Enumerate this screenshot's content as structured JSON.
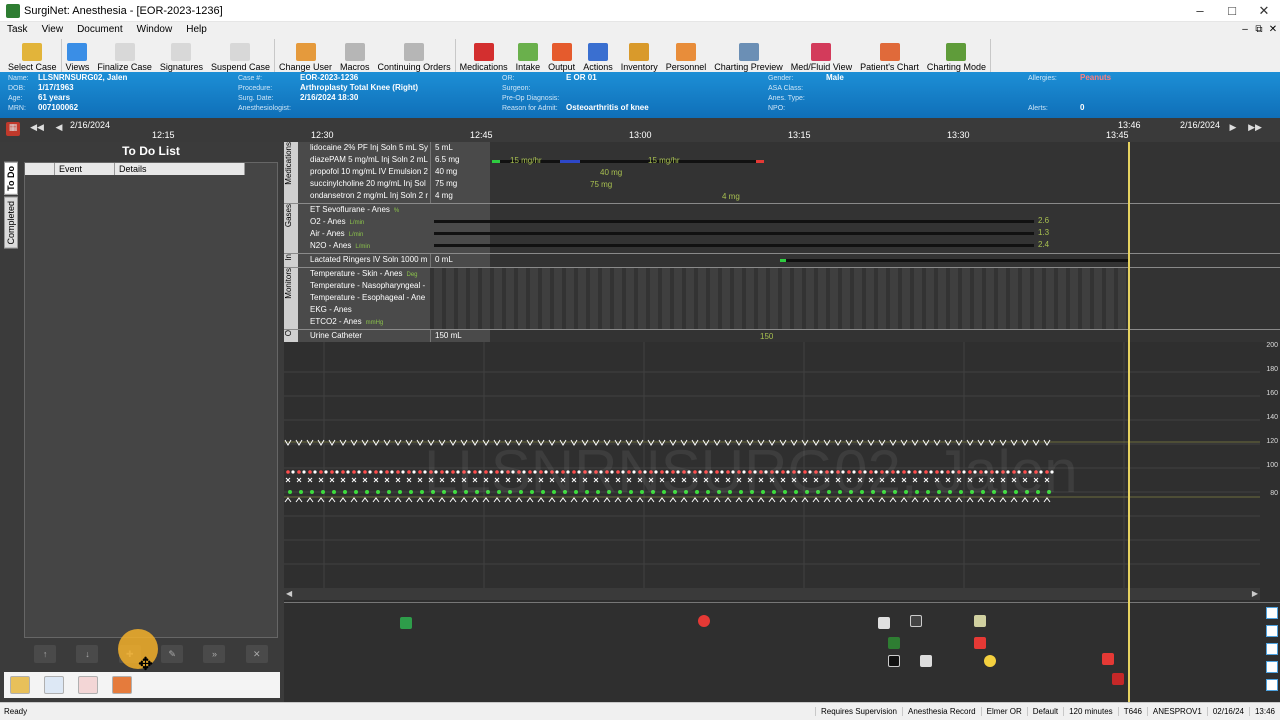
{
  "window": {
    "title": "SurgiNet: Anesthesia - [EOR-2023-1236]"
  },
  "menu": [
    "Task",
    "View",
    "Document",
    "Window",
    "Help"
  ],
  "toolbar": [
    {
      "label": "Select Case",
      "icon": "folder-icon",
      "color": "#e2b43a"
    },
    {
      "label": "Views",
      "icon": "window-icon",
      "color": "#3a8ee6"
    },
    {
      "label": "Finalize Case",
      "icon": "document-icon",
      "color": "#d8d8d8"
    },
    {
      "label": "Signatures",
      "icon": "signature-icon",
      "color": "#d8d8d8"
    },
    {
      "label": "Suspend Case",
      "icon": "suspend-icon",
      "color": "#d8d8d8"
    },
    {
      "label": "Change User",
      "icon": "users-icon",
      "color": "#e59a3c"
    },
    {
      "label": "Macros",
      "icon": "macros-icon",
      "color": "#b6b6b6"
    },
    {
      "label": "Continuing Orders",
      "icon": "orders-icon",
      "color": "#b6b6b6"
    },
    {
      "label": "Medications",
      "icon": "pill-icon",
      "color": "#d32f2f"
    },
    {
      "label": "Intake",
      "icon": "iv-bag-icon",
      "color": "#6ab04c"
    },
    {
      "label": "Output",
      "icon": "output-icon",
      "color": "#e55b2d"
    },
    {
      "label": "Actions",
      "icon": "checklist-icon",
      "color": "#3a6fd0"
    },
    {
      "label": "Inventory",
      "icon": "inventory-icon",
      "color": "#d99a2b"
    },
    {
      "label": "Personnel",
      "icon": "people-icon",
      "color": "#e88d3a"
    },
    {
      "label": "Charting Preview",
      "icon": "chart-preview-icon",
      "color": "#6b8fb5"
    },
    {
      "label": "Med/Fluid View",
      "icon": "med-fluid-icon",
      "color": "#d33b5b"
    },
    {
      "label": "Patient's Chart",
      "icon": "patient-chart-icon",
      "color": "#e06a3a"
    },
    {
      "label": "Charting Mode",
      "icon": "charting-mode-icon",
      "color": "#5f9c3a"
    }
  ],
  "patient": {
    "name_label": "Name:",
    "name": "LLSNRNSURG02, Jalen",
    "dob_label": "DOB:",
    "dob": "1/17/1963",
    "age_label": "Age:",
    "age": "61 years",
    "mrn_label": "MRN:",
    "mrn": "007100062",
    "case_label": "Case #:",
    "case": "EOR-2023-1236",
    "procedure_label": "Procedure:",
    "procedure": "Arthroplasty Total Knee (Right)",
    "surgdate_label": "Surg. Date:",
    "surgdate": "2/16/2024 18:30",
    "anesthesiologist_label": "Anesthesiologist:",
    "or_label": "OR:",
    "or": "E OR 01",
    "surgeon_label": "Surgeon:",
    "preop_label": "Pre-Op Diagnosis:",
    "reason_label": "Reason for Admit:",
    "reason": "Osteoarthritis of knee",
    "gender_label": "Gender:",
    "gender": "Male",
    "asa_label": "ASA Class:",
    "anestype_label": "Anes. Type:",
    "npo_label": "NPO:",
    "allergies_label": "Allergies:",
    "allergies": "Peanuts",
    "alerts_label": "Alerts:",
    "alerts": "0"
  },
  "timeline": {
    "date_left": "2/16/2024",
    "date_right": "2/16/2024",
    "ticks": [
      "12:15",
      "12:30",
      "12:45",
      "13:00",
      "13:15",
      "13:30",
      "13:45"
    ],
    "now": "13:46"
  },
  "todo": {
    "title": "To Do List",
    "tabs": [
      "To Do",
      "Completed"
    ],
    "columns": [
      "Event",
      "Details"
    ]
  },
  "sections": {
    "medications": {
      "tab": "Medications",
      "rows": [
        {
          "label": "lidocaine 2% PF Inj Soln 5 mL Sy",
          "value": "5 mL"
        },
        {
          "label": "diazePAM 5 mg/mL Inj Soln 2 mL",
          "value": "6.5 mg"
        },
        {
          "label": "propofol 10 mg/mL IV Emulsion 2",
          "value": "40 mg"
        },
        {
          "label": "succinylcholine 20 mg/mL Inj Sol",
          "value": "75 mg"
        },
        {
          "label": "ondansetron 2 mg/mL Inj Soln 2 r",
          "value": "4 mg"
        }
      ],
      "events": [
        {
          "text": "15 mg/hr"
        },
        {
          "text": "15 mg/hr"
        },
        {
          "text": "40 mg"
        },
        {
          "text": "75 mg"
        },
        {
          "text": "4 mg"
        }
      ]
    },
    "gases": {
      "tab": "Gases",
      "rows": [
        {
          "label": "ET Sevoflurane - Anes",
          "unit": "%"
        },
        {
          "label": "O2 - Anes",
          "unit": "L/min"
        },
        {
          "label": "Air - Anes",
          "unit": "L/min"
        },
        {
          "label": "N2O - Anes",
          "unit": "L/min"
        }
      ],
      "end_values": [
        "2.6",
        "1.3",
        "2.4"
      ]
    },
    "intake": {
      "tab": "In",
      "rows": [
        {
          "label": "Lactated Ringers IV Soln 1000 m",
          "value": "0 mL"
        }
      ]
    },
    "monitors": {
      "tab": "Monitors",
      "rows": [
        {
          "label": "Temperature - Skin - Anes",
          "unit": "Deg"
        },
        {
          "label": "Temperature - Nasopharyngeal -",
          "unit": ""
        },
        {
          "label": "Temperature - Esophageal - Ane",
          "unit": ""
        },
        {
          "label": "EKG - Anes",
          "unit": ""
        },
        {
          "label": "ETCO2 - Anes",
          "unit": "mmHg"
        }
      ]
    },
    "output": {
      "tab": "O",
      "rows": [
        {
          "label": "Urine Catheter",
          "value": "150 mL"
        }
      ],
      "events": [
        {
          "text": "150"
        }
      ]
    }
  },
  "vitals": {
    "yticks": [
      "200",
      "180",
      "160",
      "140",
      "120",
      "100",
      "80"
    ],
    "watermark": "LLSNRNSURG02, Jalen"
  },
  "status": {
    "left": "Ready",
    "cells": [
      "Requires Supervision",
      "Anesthesia Record",
      "Elmer OR",
      "Default",
      "120 minutes",
      "T646",
      "ANESPROV1",
      "02/16/24",
      "13:46"
    ]
  }
}
